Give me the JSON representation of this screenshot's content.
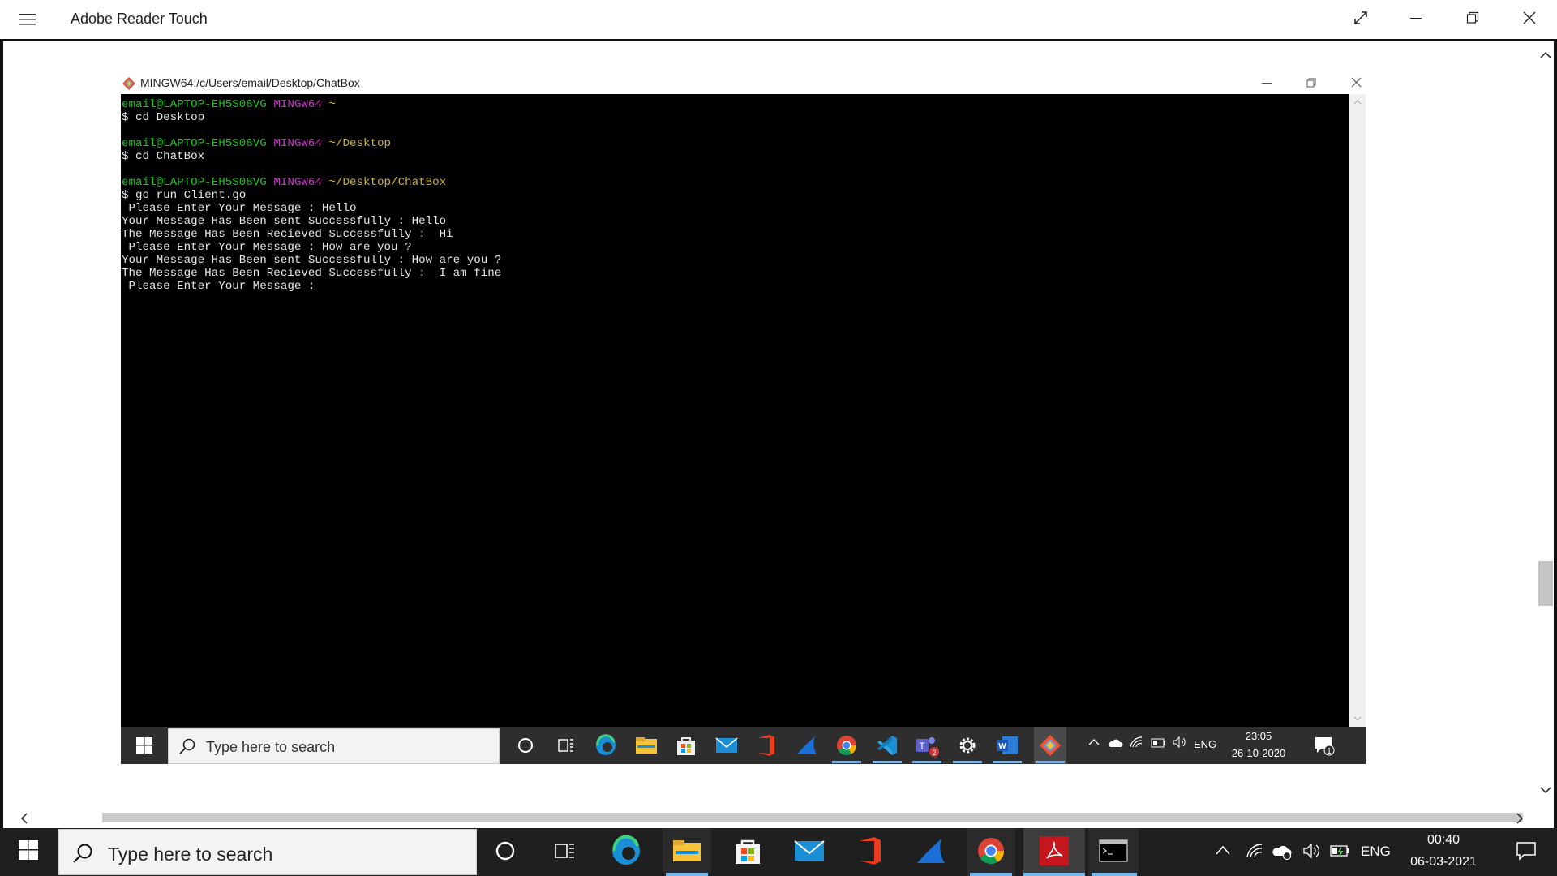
{
  "app": {
    "title": "Adobe Reader Touch"
  },
  "terminal": {
    "title": "MINGW64:/c/Users/email/Desktop/ChatBox",
    "prompts": [
      {
        "user": "email@LAPTOP-EH5S08VG",
        "shell": "MINGW64",
        "path": "~",
        "command": "$ cd Desktop"
      },
      {
        "user": "email@LAPTOP-EH5S08VG",
        "shell": "MINGW64",
        "path": "~/Desktop",
        "command": "$ cd ChatBox"
      },
      {
        "user": "email@LAPTOP-EH5S08VG",
        "shell": "MINGW64",
        "path": "~/Desktop/ChatBox",
        "command": "$ go run Client.go"
      }
    ],
    "output": [
      " Please Enter Your Message : Hello",
      "Your Message Has Been sent Successfully : Hello",
      "The Message Has Been Recieved Successfully :  Hi",
      " Please Enter Your Message : How are you ?",
      "Your Message Has Been sent Successfully : How are you ?",
      "The Message Has Been Recieved Successfully :  I am fine",
      " Please Enter Your Message :"
    ]
  },
  "inner_taskbar": {
    "search_placeholder": "Type here to search",
    "tray_lang": "ENG",
    "time": "23:05",
    "date": "26-10-2020",
    "notification_count": "1",
    "teams_badge": "2"
  },
  "taskbar": {
    "search_placeholder": "Type here to search",
    "tray_lang": "ENG",
    "time": "00:40",
    "date": "06-03-2021"
  },
  "colors": {
    "terminal_bg": "#000000",
    "prompt_user": "#1ec31e",
    "prompt_shell": "#c23ac2",
    "prompt_path": "#c8b33a",
    "taskbar_bg": "#1f1f1f",
    "accent": "#76b9ed"
  }
}
